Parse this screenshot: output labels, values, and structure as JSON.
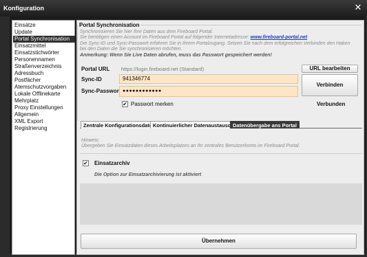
{
  "window": {
    "title": "Konfiguration",
    "close_glyph": "✕"
  },
  "sidebar": {
    "items": [
      {
        "label": "Einsätze"
      },
      {
        "label": "Update"
      },
      {
        "label": "Portal Synchronisation",
        "selected": true
      },
      {
        "label": "Einsatzmittel"
      },
      {
        "label": "Einsatzstichwörter"
      },
      {
        "label": "Personennamen"
      },
      {
        "label": "Straßenverzeichnis"
      },
      {
        "label": "Adressbuch"
      },
      {
        "label": "Postfächer"
      },
      {
        "label": "Atemschutzvorgaben"
      },
      {
        "label": "Lokale Offlinekarte"
      },
      {
        "label": "Mehrplatz"
      },
      {
        "label": "Proxy Einstellungen"
      },
      {
        "label": "Allgemein"
      },
      {
        "label": "XML Export"
      },
      {
        "label": "Registrierung"
      }
    ]
  },
  "portal": {
    "group_title": "Portal Synchronisation",
    "info_line1": "Synchronisieren Sie hier Ihre Daten aus dem Fireboard Portal.",
    "info_line2_prefix": "Sie benötigen einen Account im Fireboard Portal auf folgender Internetadresse: ",
    "info_link": "www.fireboard-portal.net",
    "info_line3": "Die Sync-ID und Sync-Passwort erfahren Sie in Ihrem Portalzugang. Setzen Sie nach dem erfolgreichen Verbinden den Haken",
    "info_line4": "bei den Daten die Sie synchronisieren möchten.",
    "info_line5": "Anmerkung: Wenn Sie Live Daten abrufen, muss das Passwort gespeichert werden!",
    "url_label": "Portal URL",
    "url_value": "https://login.fireboard.net (Standard)",
    "url_edit_button": "URL bearbeiten",
    "sync_id_label": "Sync-ID",
    "sync_id_value": "941346774",
    "sync_pw_label": "Sync-Passwort",
    "sync_pw_value": "●●●●●●●●●●●●",
    "connect_button": "Verbinden",
    "remember_pw_label": "Passwort merken",
    "remember_pw_checked": true,
    "status_text": "Verbunden"
  },
  "tabs": [
    {
      "label": "Zentrale Konfigurationsdaten",
      "active": false
    },
    {
      "label": "Kontinuierlicher Datenaustausch",
      "active": false
    },
    {
      "label": "Datenübergabe ans Portal",
      "active": true
    }
  ],
  "tab_content": {
    "hint_title": "Hinweis:",
    "hint_text": "Übergeben Sie Einsatzdaten dieses Arbeitsplatzes an Ihr zentrales Benutzerkonto im Fireboard Portal.",
    "archive_label": "Einsatzarchiv",
    "archive_checked": true,
    "archive_status": "Die Option zur Einsatzarchivierung ist aktiviert"
  },
  "footer": {
    "apply_button": "Übernehmen"
  },
  "colors": {
    "selection_bg": "#2f2f2f",
    "field_bg": "#fde6c8",
    "link": "#1a3fbf",
    "active_tab": "#3a3a3a"
  }
}
